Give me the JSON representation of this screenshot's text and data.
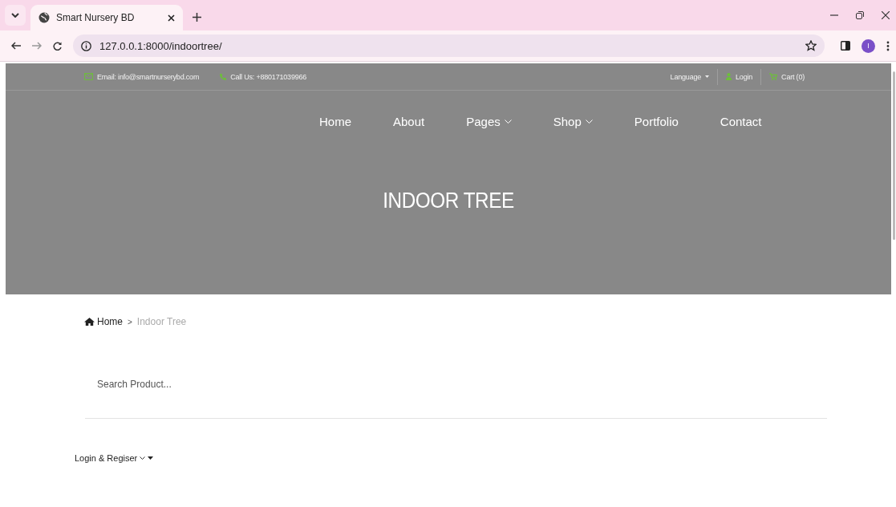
{
  "browser": {
    "tabs": [
      {
        "title": "Smart Nursery BD",
        "selected": true
      }
    ],
    "url": "127.0.0.1:8000/indoortree/",
    "profile_initial": "I"
  },
  "topbar": {
    "email": "Email: info@smartnurserybd.com",
    "phone": "Call Us: +880171039966",
    "links": [
      {
        "label": "Language",
        "kind": "dropdown"
      },
      {
        "label": "Login",
        "kind": "login"
      },
      {
        "label": "Cart (0)",
        "kind": "cart"
      }
    ]
  },
  "nav": [
    {
      "label": "Home",
      "dropdown": false
    },
    {
      "label": "About",
      "dropdown": false
    },
    {
      "label": "Pages",
      "dropdown": true
    },
    {
      "label": "Shop",
      "dropdown": true
    },
    {
      "label": "Portfolio",
      "dropdown": false
    },
    {
      "label": "Contact",
      "dropdown": false
    }
  ],
  "hero": {
    "title": "INDOOR TREE"
  },
  "breadcrumb": {
    "separator": ">",
    "items": [
      {
        "label": "Home",
        "current": false
      },
      {
        "label": "Indoor Tree",
        "current": true
      }
    ]
  },
  "search": {
    "placeholder": "Search Product..."
  },
  "account_menu": {
    "label": "Login & Regiser"
  }
}
